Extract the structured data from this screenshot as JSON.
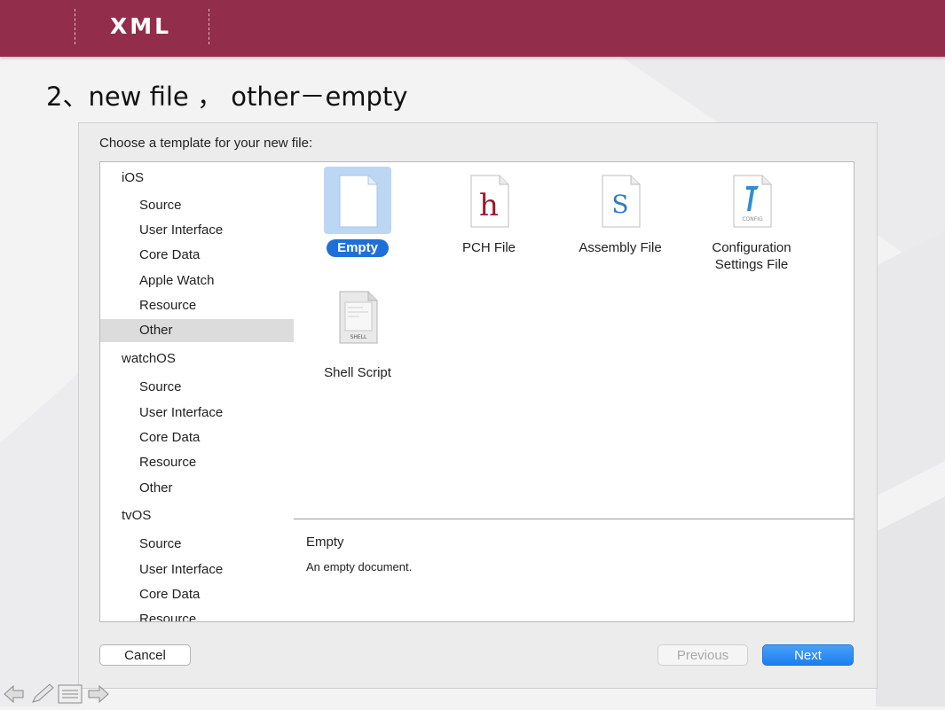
{
  "header": {
    "title": "XML"
  },
  "slide": {
    "heading": "2、new file ， other－empty"
  },
  "dialog": {
    "prompt": "Choose a template for your new file:",
    "sidebar": {
      "groups": [
        {
          "name": "iOS",
          "items": [
            "Source",
            "User Interface",
            "Core Data",
            "Apple Watch",
            "Resource",
            "Other"
          ]
        },
        {
          "name": "watchOS",
          "items": [
            "Source",
            "User Interface",
            "Core Data",
            "Resource",
            "Other"
          ]
        },
        {
          "name": "tvOS",
          "items": [
            "Source",
            "User Interface",
            "Core Data",
            "Resource"
          ]
        }
      ],
      "selected": "Other"
    },
    "templates": [
      {
        "label": "Empty",
        "icon": "blank-document-icon",
        "selected": true
      },
      {
        "label": "PCH File",
        "icon": "pch-file-icon",
        "glyph": "h"
      },
      {
        "label": "Assembly File",
        "icon": "assembly-file-icon",
        "glyph": "S"
      },
      {
        "label": "Configuration Settings File",
        "label_line1": "Configuration",
        "label_line2": "Settings File",
        "icon": "config-file-icon",
        "badge": "CONFIG"
      },
      {
        "label": "Shell Script",
        "icon": "shell-script-icon",
        "badge": "SHELL"
      }
    ],
    "description": {
      "title": "Empty",
      "text": "An empty document."
    },
    "buttons": {
      "cancel": "Cancel",
      "previous": "Previous",
      "next": "Next"
    }
  },
  "colors": {
    "header": "#922d4b",
    "accent": "#1e6fd9",
    "selection": "#bcd7f3"
  },
  "slide_controls": [
    "prev-arrow-icon",
    "pen-icon",
    "menu-icon",
    "next-arrow-icon"
  ]
}
